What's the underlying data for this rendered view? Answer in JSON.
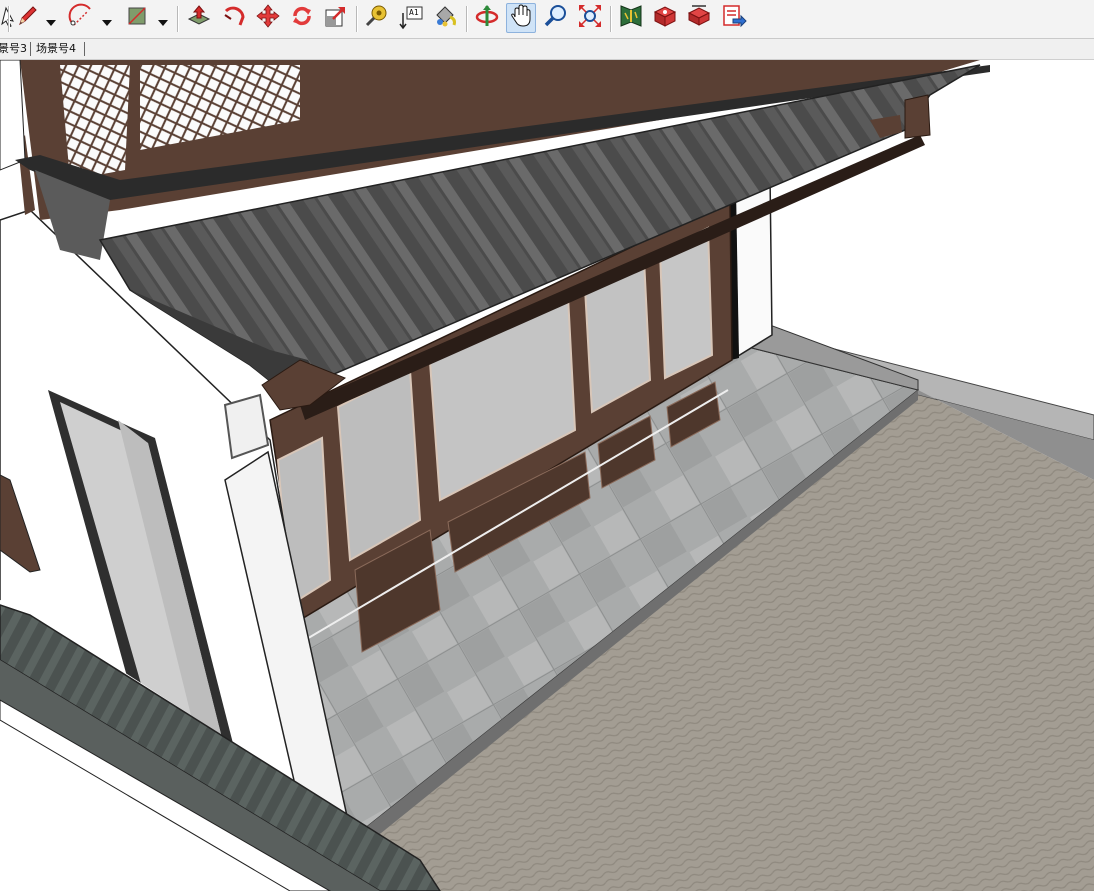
{
  "toolbar": {
    "tools": [
      {
        "name": "select-tool",
        "icon": "select-arrow-icon"
      },
      {
        "name": "pencil-tool",
        "icon": "pencil-icon"
      },
      {
        "name": "arc-tool",
        "icon": "arc-icon"
      },
      {
        "name": "shape-tool",
        "icon": "rectangle-icon"
      },
      {
        "name": "push-pull-tool",
        "icon": "push-pull-icon"
      },
      {
        "name": "follow-me-tool",
        "icon": "follow-me-icon"
      },
      {
        "name": "move-tool",
        "icon": "move-icon"
      },
      {
        "name": "rotate-tool",
        "icon": "rotate-icon"
      },
      {
        "name": "scale-tool",
        "icon": "scale-icon"
      },
      {
        "name": "tape-measure-tool",
        "icon": "tape-measure-icon"
      },
      {
        "name": "text-tool",
        "icon": "text-icon"
      },
      {
        "name": "paint-bucket-tool",
        "icon": "paint-bucket-icon"
      },
      {
        "name": "orbit-tool",
        "icon": "orbit-icon"
      },
      {
        "name": "pan-tool",
        "icon": "pan-hand-icon",
        "active": true
      },
      {
        "name": "zoom-tool",
        "icon": "zoom-icon"
      },
      {
        "name": "zoom-extents-tool",
        "icon": "zoom-extents-icon"
      },
      {
        "name": "warehouse-tool",
        "icon": "warehouse-icon"
      },
      {
        "name": "extension-tool",
        "icon": "extension-icon"
      },
      {
        "name": "share-model-tool",
        "icon": "share-model-icon"
      },
      {
        "name": "send-to-layout-tool",
        "icon": "send-to-layout-icon"
      }
    ],
    "text_tool_glyph": "A1"
  },
  "scene_tabs": [
    {
      "label": "景号3"
    },
    {
      "label": "场景号4"
    }
  ],
  "colors": {
    "toolbar_bg": "#f3f3f3",
    "roof_tile": "#4a4a4a",
    "wood": "#5a4034",
    "glass": "#bdbdbd",
    "stone_floor": "#a7a9a9",
    "courtyard": "#a09a90",
    "wall": "#ffffff",
    "active_tool": "#cfe3f7",
    "accent_red": "#d42b2b"
  }
}
